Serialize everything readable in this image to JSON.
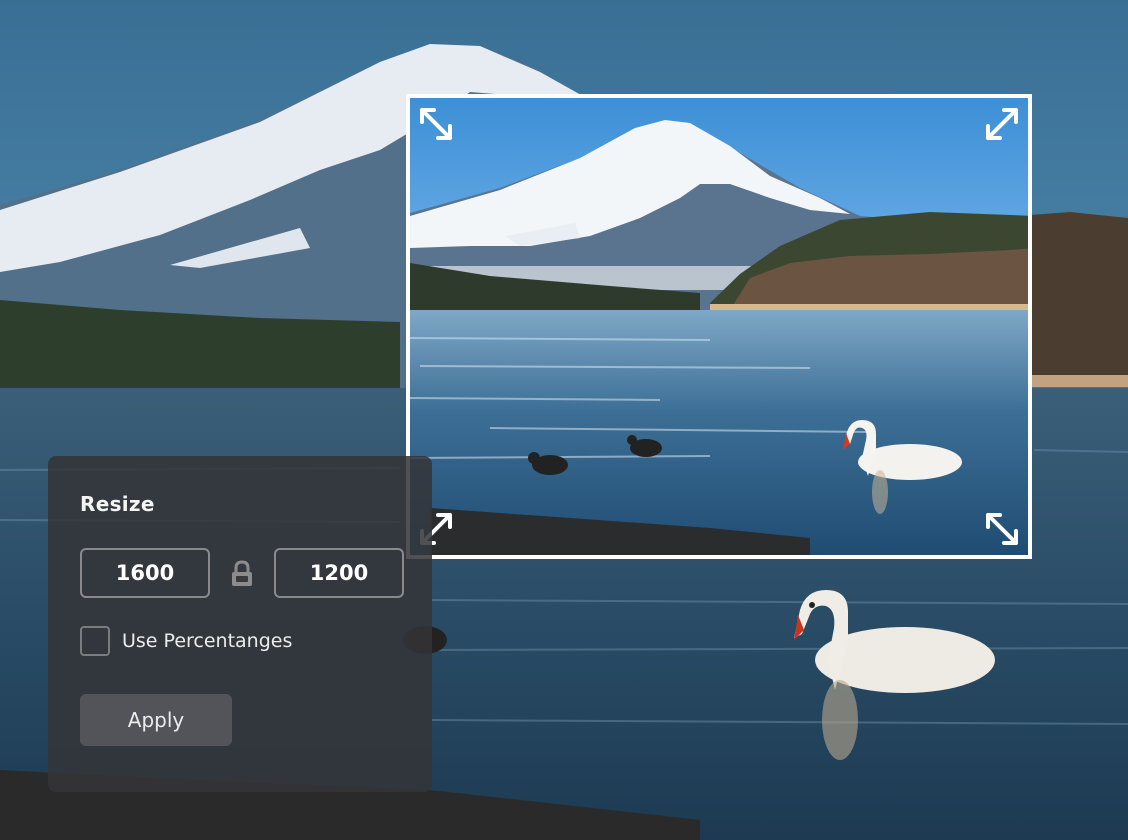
{
  "panel": {
    "title": "Resize",
    "width_value": "1600",
    "height_value": "1200",
    "lock_icon": "lock-icon",
    "checkbox_label": "Use Percentanges",
    "checkbox_checked": false,
    "apply_label": "Apply"
  },
  "crop_frame": {
    "handle_icons": [
      "resize-nw-icon",
      "resize-ne-icon",
      "resize-sw-icon",
      "resize-se-icon"
    ],
    "border_color": "#ffffff"
  },
  "colors": {
    "panel_bg": "#343438",
    "panel_text": "#f2f2f2",
    "input_border": "#8a8a8a"
  }
}
